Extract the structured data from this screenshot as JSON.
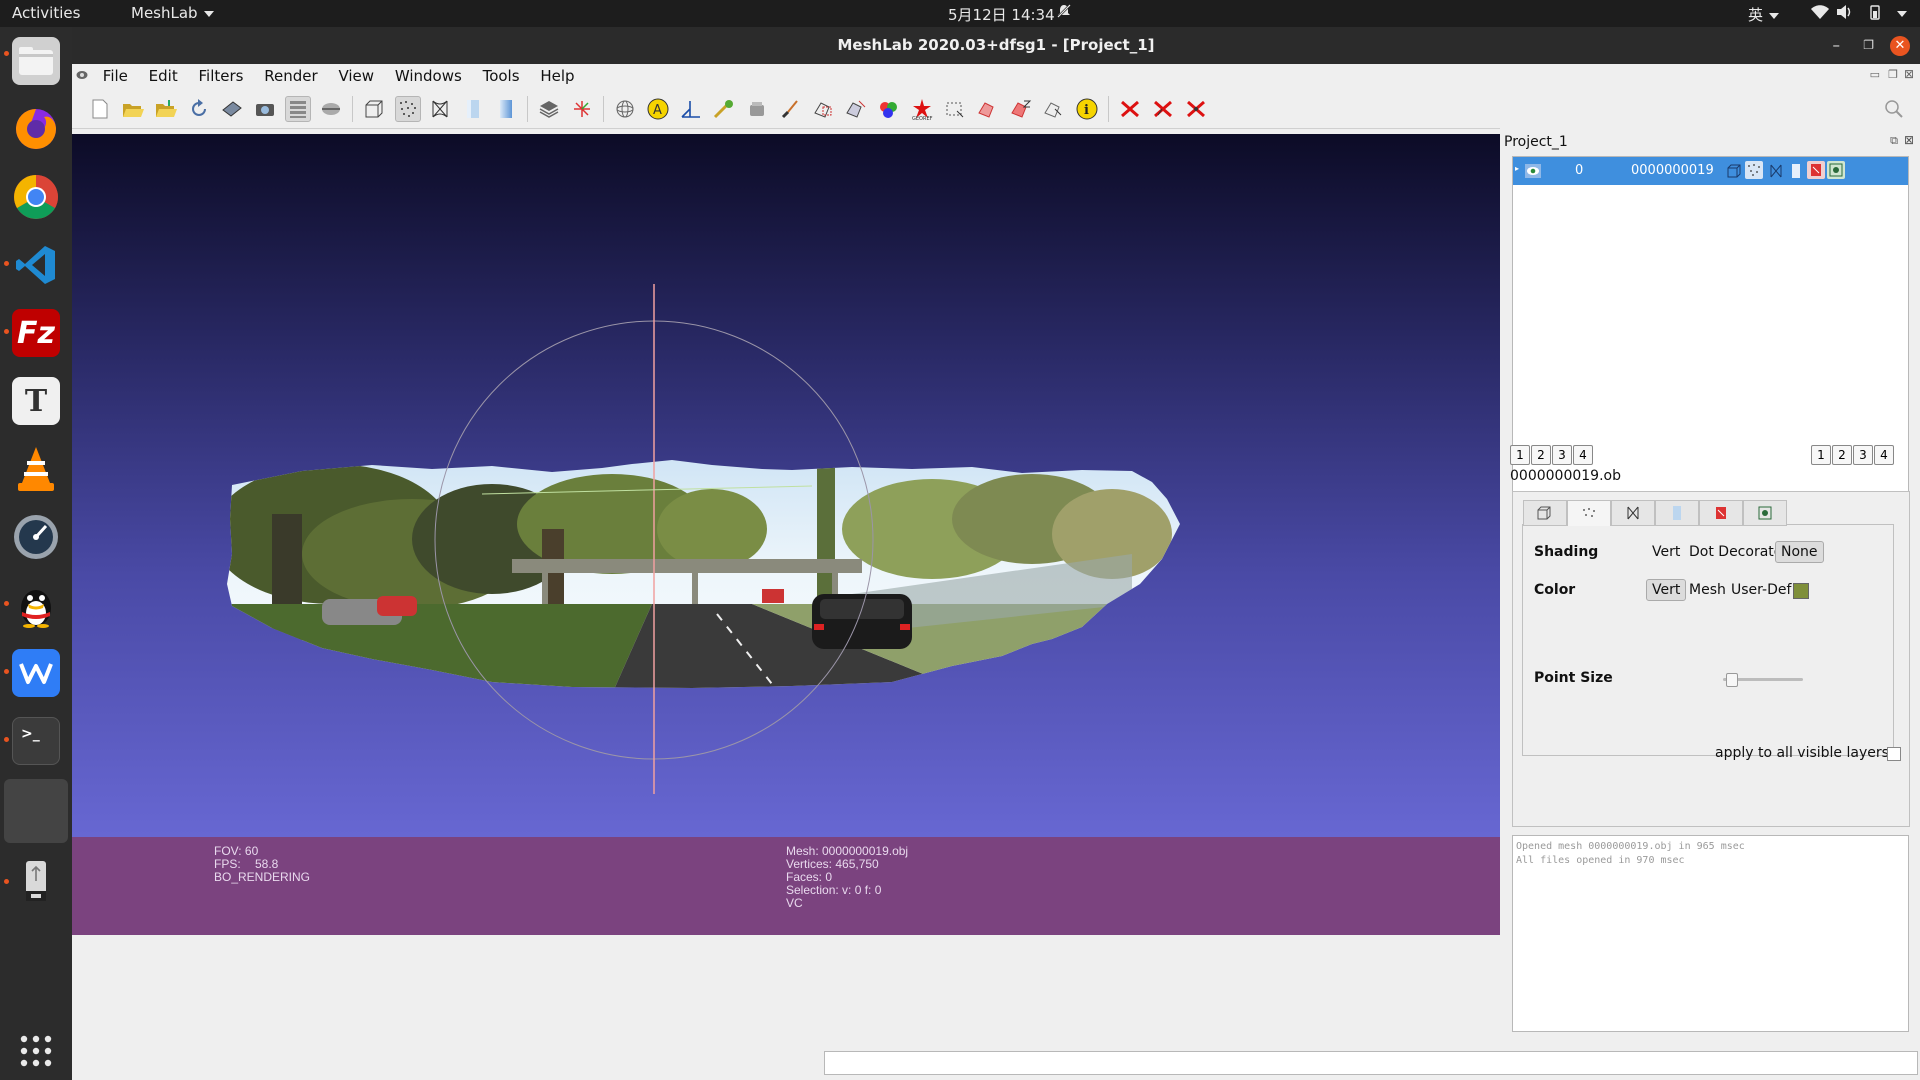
{
  "topbar": {
    "activities": "Activities",
    "app_menu": "MeshLab",
    "datetime": "5月12日  14:34",
    "input_method": "英"
  },
  "window": {
    "title": "MeshLab 2020.03+dfsg1 - [Project_1]"
  },
  "menubar": [
    "File",
    "Edit",
    "Filters",
    "Render",
    "View",
    "Windows",
    "Tools",
    "Help"
  ],
  "viewport_info": {
    "fov": "FOV: 60",
    "fps_label": "FPS:",
    "fps_value": "58.8",
    "rendering": "BO_RENDERING",
    "mesh": "Mesh: 0000000019.obj",
    "vertices": "Vertices: 465,750",
    "faces": "Faces: 0",
    "selection": "Selection: v: 0 f: 0",
    "vc": "VC"
  },
  "layer_panel": {
    "title": "Project_1",
    "layer_index": "0",
    "layer_name": "0000000019",
    "numbers_left": [
      "1",
      "2",
      "3",
      "4"
    ],
    "numbers_right": [
      "1",
      "2",
      "3",
      "4"
    ],
    "mesh_file": "0000000019.ob"
  },
  "render_props": {
    "shading_label": "Shading",
    "shading_options": [
      "Vert",
      "Dot Decorator",
      "None"
    ],
    "shading_selected": "None",
    "color_label": "Color",
    "color_options": [
      "Vert",
      "Mesh",
      "User-Def"
    ],
    "color_selected": "Vert",
    "user_def_color": "#7f8f3a",
    "point_size_label": "Point Size",
    "point_size_level": 0.05,
    "apply_all": "apply to all visible layers"
  },
  "log": [
    "Opened mesh 0000000019.obj in 965 msec",
    "All files opened in 970 msec"
  ],
  "colors": {
    "selection_blue": "#3f8fde",
    "info_panel": "#7b437f",
    "ubuntu_orange": "#e95420"
  }
}
